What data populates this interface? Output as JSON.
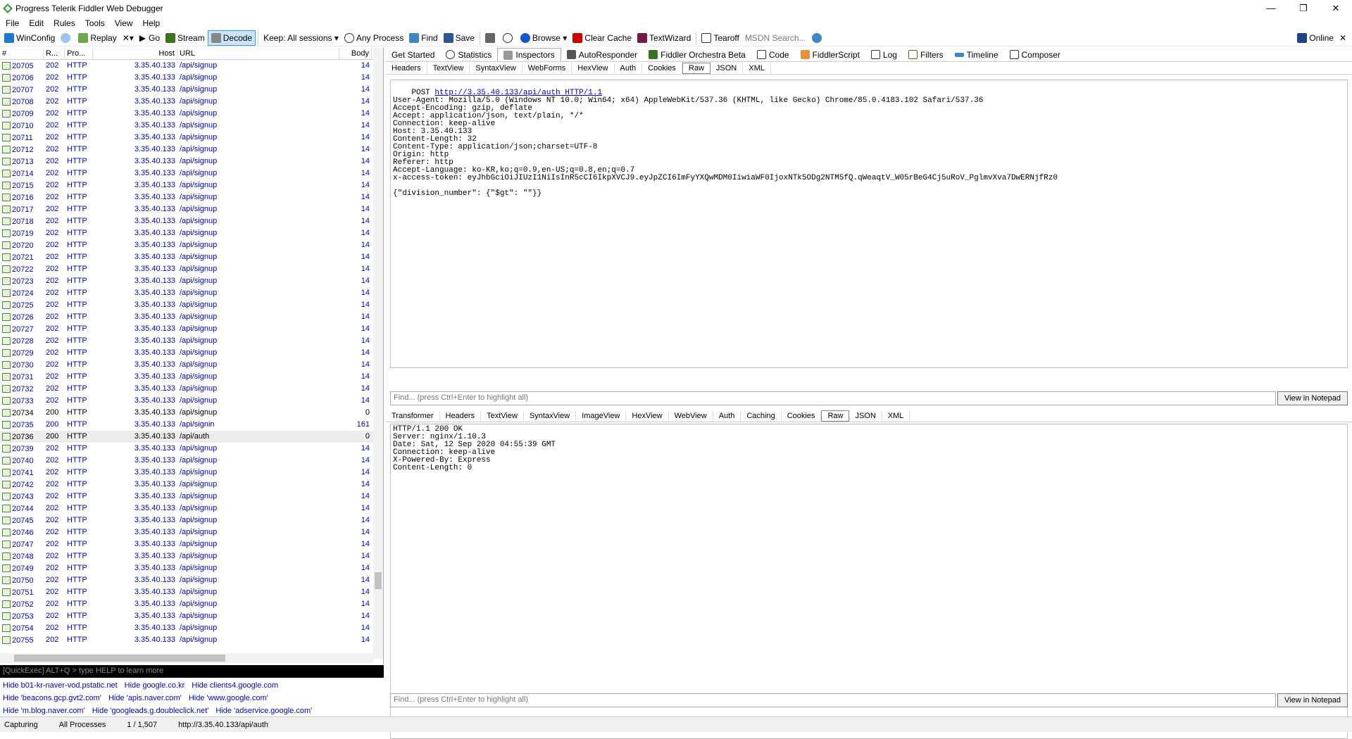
{
  "window": {
    "title": "Progress Telerik Fiddler Web Debugger",
    "minimize": "—",
    "restore": "❐",
    "close": "✕"
  },
  "menu": [
    "File",
    "Edit",
    "Rules",
    "Tools",
    "View",
    "Help"
  ],
  "toolbar": {
    "winconfig": "WinConfig",
    "replay": "Replay",
    "remove": "✕▾",
    "go": "Go",
    "stream": "Stream",
    "decode": "Decode",
    "keep": "Keep: All sessions ▾",
    "process": "Any Process",
    "find": "Find",
    "save": "Save",
    "browse": "Browse ▾",
    "clear_cache": "Clear Cache",
    "textwizard": "TextWizard",
    "tearoff": "Tearoff",
    "msdn": "MSDN Search...",
    "online": "Online",
    "online_close": "✕"
  },
  "sessions": {
    "headers": [
      "#",
      "R...",
      "Pro...",
      "Host",
      "URL",
      "Body"
    ],
    "rows": [
      [
        "20705",
        "202",
        "HTTP",
        "3.35.40.133",
        "/api/signup",
        "14"
      ],
      [
        "20706",
        "202",
        "HTTP",
        "3.35.40.133",
        "/api/signup",
        "14"
      ],
      [
        "20707",
        "202",
        "HTTP",
        "3.35.40.133",
        "/api/signup",
        "14"
      ],
      [
        "20708",
        "202",
        "HTTP",
        "3.35.40.133",
        "/api/signup",
        "14"
      ],
      [
        "20709",
        "202",
        "HTTP",
        "3.35.40.133",
        "/api/signup",
        "14"
      ],
      [
        "20710",
        "202",
        "HTTP",
        "3.35.40.133",
        "/api/signup",
        "14"
      ],
      [
        "20711",
        "202",
        "HTTP",
        "3.35.40.133",
        "/api/signup",
        "14"
      ],
      [
        "20712",
        "202",
        "HTTP",
        "3.35.40.133",
        "/api/signup",
        "14"
      ],
      [
        "20713",
        "202",
        "HTTP",
        "3.35.40.133",
        "/api/signup",
        "14"
      ],
      [
        "20714",
        "202",
        "HTTP",
        "3.35.40.133",
        "/api/signup",
        "14"
      ],
      [
        "20715",
        "202",
        "HTTP",
        "3.35.40.133",
        "/api/signup",
        "14"
      ],
      [
        "20716",
        "202",
        "HTTP",
        "3.35.40.133",
        "/api/signup",
        "14"
      ],
      [
        "20717",
        "202",
        "HTTP",
        "3.35.40.133",
        "/api/signup",
        "14"
      ],
      [
        "20718",
        "202",
        "HTTP",
        "3.35.40.133",
        "/api/signup",
        "14"
      ],
      [
        "20719",
        "202",
        "HTTP",
        "3.35.40.133",
        "/api/signup",
        "14"
      ],
      [
        "20720",
        "202",
        "HTTP",
        "3.35.40.133",
        "/api/signup",
        "14"
      ],
      [
        "20721",
        "202",
        "HTTP",
        "3.35.40.133",
        "/api/signup",
        "14"
      ],
      [
        "20722",
        "202",
        "HTTP",
        "3.35.40.133",
        "/api/signup",
        "14"
      ],
      [
        "20723",
        "202",
        "HTTP",
        "3.35.40.133",
        "/api/signup",
        "14"
      ],
      [
        "20724",
        "202",
        "HTTP",
        "3.35.40.133",
        "/api/signup",
        "14"
      ],
      [
        "20725",
        "202",
        "HTTP",
        "3.35.40.133",
        "/api/signup",
        "14"
      ],
      [
        "20726",
        "202",
        "HTTP",
        "3.35.40.133",
        "/api/signup",
        "14"
      ],
      [
        "20727",
        "202",
        "HTTP",
        "3.35.40.133",
        "/api/signup",
        "14"
      ],
      [
        "20728",
        "202",
        "HTTP",
        "3.35.40.133",
        "/api/signup",
        "14"
      ],
      [
        "20729",
        "202",
        "HTTP",
        "3.35.40.133",
        "/api/signup",
        "14"
      ],
      [
        "20730",
        "202",
        "HTTP",
        "3.35.40.133",
        "/api/signup",
        "14"
      ],
      [
        "20731",
        "202",
        "HTTP",
        "3.35.40.133",
        "/api/signup",
        "14"
      ],
      [
        "20732",
        "202",
        "HTTP",
        "3.35.40.133",
        "/api/signup",
        "14"
      ],
      [
        "20733",
        "202",
        "HTTP",
        "3.35.40.133",
        "/api/signup",
        "14"
      ],
      [
        "20734",
        "200",
        "HTTP",
        "3.35.40.133",
        "/api/signup",
        "0"
      ],
      [
        "20735",
        "200",
        "HTTP",
        "3.35.40.133",
        "/api/signin",
        "161"
      ],
      [
        "20736",
        "200",
        "HTTP",
        "3.35.40.133",
        "/api/auth",
        "0"
      ],
      [
        "20739",
        "202",
        "HTTP",
        "3.35.40.133",
        "/api/signup",
        "14"
      ],
      [
        "20740",
        "202",
        "HTTP",
        "3.35.40.133",
        "/api/signup",
        "14"
      ],
      [
        "20741",
        "202",
        "HTTP",
        "3.35.40.133",
        "/api/signup",
        "14"
      ],
      [
        "20742",
        "202",
        "HTTP",
        "3.35.40.133",
        "/api/signup",
        "14"
      ],
      [
        "20743",
        "202",
        "HTTP",
        "3.35.40.133",
        "/api/signup",
        "14"
      ],
      [
        "20744",
        "202",
        "HTTP",
        "3.35.40.133",
        "/api/signup",
        "14"
      ],
      [
        "20745",
        "202",
        "HTTP",
        "3.35.40.133",
        "/api/signup",
        "14"
      ],
      [
        "20746",
        "202",
        "HTTP",
        "3.35.40.133",
        "/api/signup",
        "14"
      ],
      [
        "20747",
        "202",
        "HTTP",
        "3.35.40.133",
        "/api/signup",
        "14"
      ],
      [
        "20748",
        "202",
        "HTTP",
        "3.35.40.133",
        "/api/signup",
        "14"
      ],
      [
        "20749",
        "202",
        "HTTP",
        "3.35.40.133",
        "/api/signup",
        "14"
      ],
      [
        "20750",
        "202",
        "HTTP",
        "3.35.40.133",
        "/api/signup",
        "14"
      ],
      [
        "20751",
        "202",
        "HTTP",
        "3.35.40.133",
        "/api/signup",
        "14"
      ],
      [
        "20752",
        "202",
        "HTTP",
        "3.35.40.133",
        "/api/signup",
        "14"
      ],
      [
        "20753",
        "202",
        "HTTP",
        "3.35.40.133",
        "/api/signup",
        "14"
      ],
      [
        "20754",
        "202",
        "HTTP",
        "3.35.40.133",
        "/api/signup",
        "14"
      ],
      [
        "20755",
        "202",
        "HTTP",
        "3.35.40.133",
        "/api/signup",
        "14"
      ]
    ],
    "selected_index": 31,
    "black_indices": [
      29,
      31
    ]
  },
  "quickexec": "[QuickExec] ALT+Q > type HELP to learn more",
  "hides": [
    [
      "Hide b01-kr-naver-vod.pstatic.net",
      "Hide google.co.kr",
      "Hide clients4.google.com"
    ],
    [
      "Hide 'beacons.gcp.gvt2.com'",
      "Hide 'apis.naver.com'",
      "Hide 'www.google.com'"
    ],
    [
      "Hide 'm.blog.naver.com'",
      "Hide 'googleads.g.doubleclick.net'",
      "Hide 'adservice.google.com'"
    ]
  ],
  "tabs": [
    "Get Started",
    "Statistics",
    "Inspectors",
    "AutoResponder",
    "Fiddler Orchestra Beta",
    "Code",
    "FiddlerScript",
    "Log",
    "Filters",
    "Timeline",
    "Composer"
  ],
  "request_tabs": [
    "Headers",
    "TextView",
    "SyntaxView",
    "WebForms",
    "HexView",
    "Auth",
    "Cookies",
    "Raw",
    "JSON",
    "XML"
  ],
  "response_tabs": [
    "Transformer",
    "Headers",
    "TextView",
    "SyntaxView",
    "ImageView",
    "HexView",
    "WebView",
    "Auth",
    "Caching",
    "Cookies",
    "Raw",
    "JSON",
    "XML"
  ],
  "request": {
    "method": "POST",
    "url": "http://3.35.40.133/api/auth HTTP/1.1",
    "body": "User-Agent: Mozilla/5.0 (Windows NT 10.0; Win64; x64) AppleWebKit/537.36 (KHTML, like Gecko) Chrome/85.0.4183.102 Safari/537.36\nAccept-Encoding: gzip, deflate\nAccept: application/json, text/plain, */*\nConnection: keep-alive\nHost: 3.35.40.133\nContent-Length: 32\nContent-Type: application/json;charset=UTF-8\nOrigin: http\nReferer: http\nAccept-Language: ko-KR,ko;q=0.9,en-US;q=0.8,en;q=0.7\nx-access-token: eyJhbGciOiJIUzI1NiIsInR5cCI6IkpXVCJ9.eyJpZCI6ImFyYXQwMDM0IiwiaWF0IjoxNTk5ODg2NTM5fQ.qWeaqtV_W05rBeG4Cj5uRoV_PglmvXva7DwERNjfRz0\n\n{\"division_number\": {\"$gt\": \"\"}}"
  },
  "response": {
    "body": "HTTP/1.1 200 OK\nServer: nginx/1.10.3\nDate: Sat, 12 Sep 2020 04:55:39 GMT\nConnection: keep-alive\nX-Powered-By: Express\nContent-Length: 0"
  },
  "find_placeholder": "Find... (press Ctrl+Enter to highlight all)",
  "view_notepad": "View in Notepad",
  "statusbar": {
    "capturing": "Capturing",
    "processes": "All Processes",
    "count": "1 / 1,507",
    "url": "http://3.35.40.133/api/auth"
  }
}
